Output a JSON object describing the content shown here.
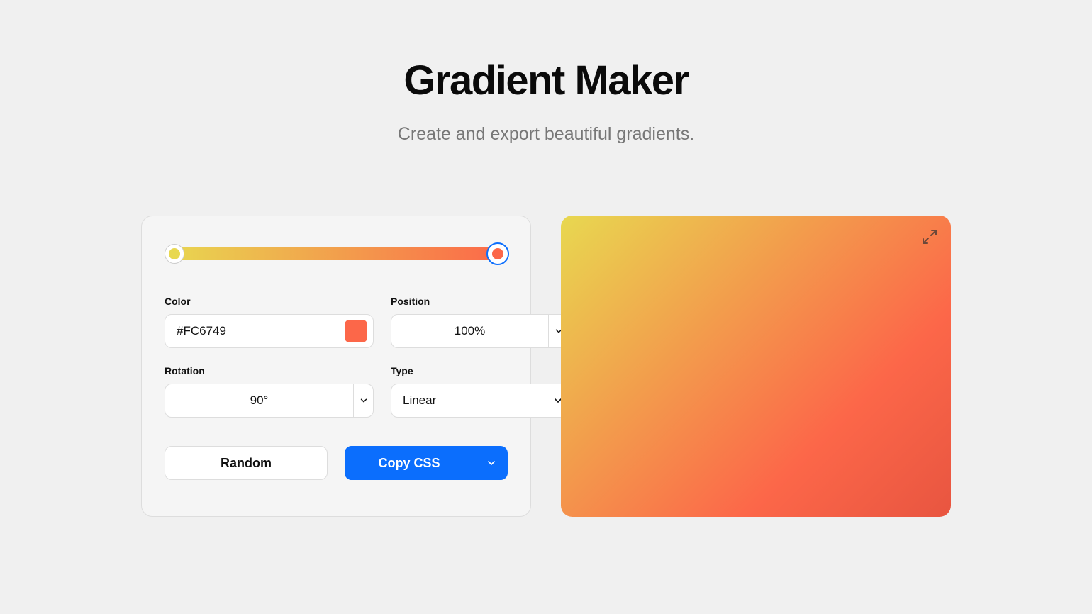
{
  "header": {
    "title": "Gradient Maker",
    "subtitle": "Create and export beautiful gradients."
  },
  "controls": {
    "color": {
      "label": "Color",
      "value": "#FC6749",
      "swatch_color": "#fc6749"
    },
    "position": {
      "label": "Position",
      "value": "100%"
    },
    "rotation": {
      "label": "Rotation",
      "value": "90°"
    },
    "type": {
      "label": "Type",
      "value": "Linear"
    }
  },
  "gradient": {
    "stops": [
      {
        "color": "#e8d850",
        "position": 0
      },
      {
        "color": "#fc6749",
        "position": 100
      }
    ],
    "active_stop_index": 1
  },
  "buttons": {
    "random": "Random",
    "copy": "Copy CSS"
  }
}
